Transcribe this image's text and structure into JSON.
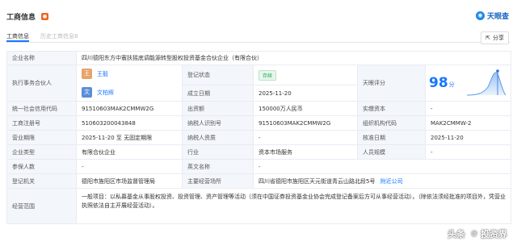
{
  "header": {
    "title": "工商信息",
    "badge": "●"
  },
  "brand": {
    "name": "天眼查",
    "icon": "tianyancha-logo-icon"
  },
  "tabs": [
    {
      "label": "工商信息",
      "active": true
    },
    {
      "label": "历史工商信息",
      "count": "8",
      "active": false
    }
  ],
  "share": {
    "label": "分享",
    "icon": "share-icon"
  },
  "company": {
    "name_label": "企业名称",
    "name": "四川德阳东方中寰扶摇底调能源转型股权投资基金合伙企业（有限合伙）",
    "partner_label": "执行事务合伙人",
    "partners": [
      {
        "avatar": "王",
        "name": "王毅",
        "color": "#e6a36a"
      },
      {
        "avatar": "文",
        "name": "文柏辉",
        "color": "#5a8ed8"
      }
    ],
    "status_label": "登记状态",
    "status": "存续",
    "founded_label": "成立日期",
    "founded": "2025-11-20",
    "score_label": "天眼评分",
    "score": "98",
    "score_unit": "分",
    "credit_label": "统一社会信用代码",
    "credit": "91510603MAK2CMMW2G",
    "capital_label": "出资额",
    "capital": "150000万人民币",
    "paid_label": "实缴资本",
    "paid": "-",
    "reg_label": "工商注册号",
    "reg": "510603200043848",
    "taxid_label": "纳税人识别号",
    "taxid": "91510603MAK2CMMW2G",
    "org_label": "组织机构代码",
    "org": "MAK2CMMW-2",
    "term_label": "营业期限",
    "term": "2025-11-20 至 无固定期限",
    "taxq_label": "纳税人资质",
    "taxq": "-",
    "approve_label": "核准日期",
    "approve": "2025-11-20",
    "type_label": "企业类型",
    "type": "有限合伙企业",
    "industry_label": "行业",
    "industry": "资本市场服务",
    "staff_label": "人员规模",
    "staff": "-",
    "insured_label": "参保人数",
    "insured": "-",
    "en_label": "英文名称",
    "en": "-",
    "authority_label": "登记机关",
    "authority": "德阳市旌阳区市场监督管理局",
    "addr_label": "主要经营场所",
    "addr": "四川省德阳市旌阳区天元街道青云山路北段5号",
    "addr_link": "附近公司",
    "scope_label": "经营范围",
    "scope": "一般项目：以私募基金从事股权投资、投资管理、资产管理等活动（须在中国证券投资基金业协会完成登记备案后方可从事经营活动）。（除依法须经批准的项目外，凭营业执照依法自主开展经营活动）。"
  },
  "watermark": {
    "text1": "头条",
    "text2": "投资界",
    "icon": "at-icon"
  }
}
